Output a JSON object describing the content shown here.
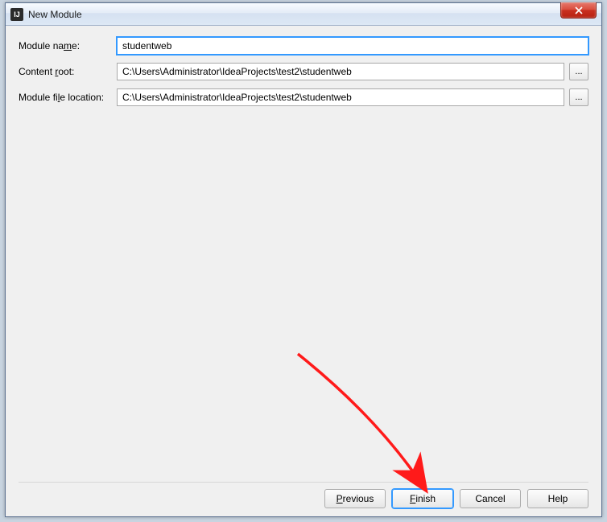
{
  "window": {
    "title": "New Module",
    "icon_glyph": "IJ"
  },
  "form": {
    "module_name_label_prefix": "Module na",
    "module_name_label_ul": "m",
    "module_name_label_suffix": "e:",
    "module_name_value": "studentweb",
    "content_root_label_prefix": "Content ",
    "content_root_label_ul": "r",
    "content_root_label_suffix": "oot:",
    "content_root_value": "C:\\Users\\Administrator\\IdeaProjects\\test2\\studentweb",
    "module_file_label_prefix": "Module fi",
    "module_file_label_ul": "l",
    "module_file_label_suffix": "e location:",
    "module_file_value": "C:\\Users\\Administrator\\IdeaProjects\\test2\\studentweb",
    "browse_label": "..."
  },
  "buttons": {
    "previous_ul": "P",
    "previous_rest": "revious",
    "finish_ul": "F",
    "finish_rest": "inish",
    "cancel": "Cancel",
    "help": "Help"
  }
}
